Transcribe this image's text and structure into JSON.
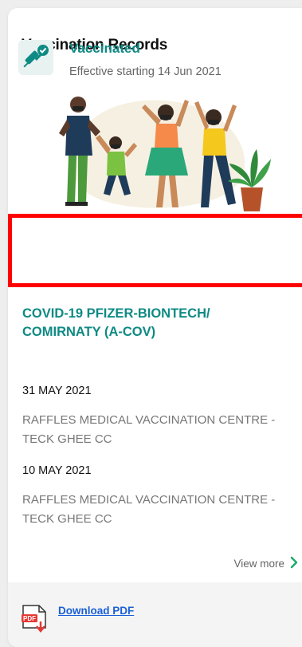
{
  "header": {
    "title": "Vaccination Records"
  },
  "status": {
    "label": "Vaccinated",
    "effective_text": "Effective starting 14 Jun 2021",
    "icon": "syringe-check-icon"
  },
  "vaccine": {
    "name": "COVID-19 PFIZER-BIONTECH/ COMIRNATY (A-COV)"
  },
  "doses": [
    {
      "date": "31 MAY 2021",
      "venue": "RAFFLES MEDICAL VACCINATION CENTRE - TECK GHEE CC"
    },
    {
      "date": "10 MAY 2021",
      "venue": "RAFFLES MEDICAL VACCINATION CENTRE - TECK GHEE CC"
    }
  ],
  "actions": {
    "view_more_label": "View more",
    "download_label": "Download PDF",
    "pdf_icon_text": "PDF"
  },
  "colors": {
    "accent": "#0e8a84",
    "highlight_border": "#ff0000",
    "link": "#1a5fd6"
  }
}
